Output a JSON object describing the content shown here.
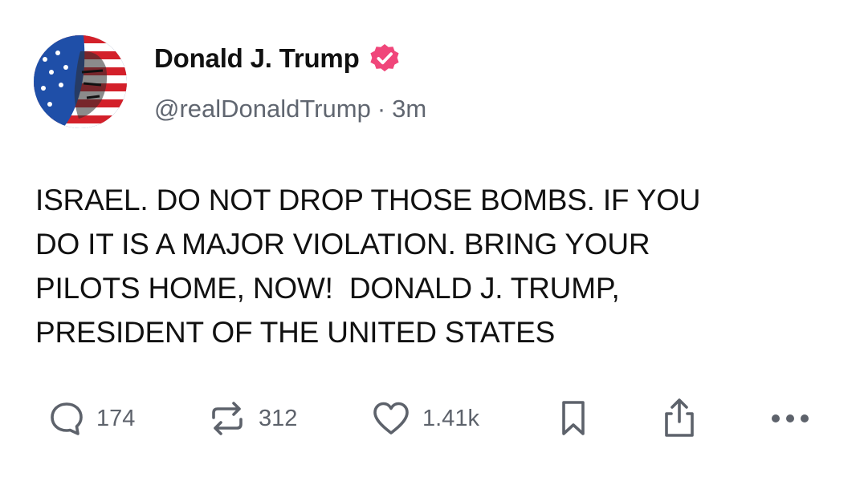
{
  "author": {
    "name": "Donald J. Trump",
    "handle": "@realDonaldTrump",
    "separator": "·",
    "time": "3m",
    "verified_color": "#f0467a",
    "avatar_icon": "flag-face-avatar"
  },
  "post": {
    "text": "ISRAEL. DO NOT DROP THOSE BOMBS. IF YOU\nDO IT IS A MAJOR VIOLATION. BRING YOUR\nPILOTS HOME, NOW!  DONALD J. TRUMP,\nPRESIDENT OF THE UNITED STATES"
  },
  "actions": {
    "replies": "174",
    "reposts": "312",
    "likes": "1.41k",
    "icons": [
      "reply-icon",
      "repost-icon",
      "like-icon",
      "bookmark-icon",
      "share-icon",
      "more-icon"
    ]
  }
}
